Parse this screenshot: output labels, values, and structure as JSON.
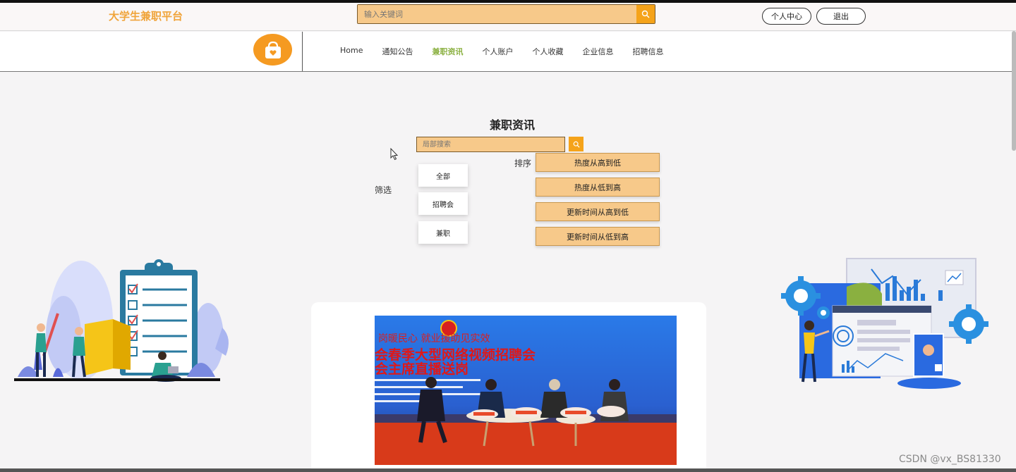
{
  "header": {
    "site_title": "大学生兼职平台",
    "search_placeholder": "输入关键词",
    "personal_center": "个人中心",
    "logout": "退出"
  },
  "nav": {
    "items": [
      {
        "label": "Home",
        "active": false
      },
      {
        "label": "通知公告",
        "active": false
      },
      {
        "label": "兼职资讯",
        "active": true
      },
      {
        "label": "个人账户",
        "active": false
      },
      {
        "label": "个人收藏",
        "active": false
      },
      {
        "label": "企业信息",
        "active": false
      },
      {
        "label": "招聘信息",
        "active": false
      }
    ]
  },
  "main": {
    "title": "兼职资讯",
    "local_search_placeholder": "局部搜索",
    "filter_label": "筛选",
    "filters": [
      "全部",
      "招聘会",
      "兼职"
    ],
    "sort_label": "排序",
    "sorts": [
      "热度从高到低",
      "热度从低到高",
      "更新时间从高到低",
      "更新时间从低到高"
    ]
  },
  "news_card": {
    "banner_line1": "岗暖民心  就业援助见实效",
    "banner_line2": "会春季大型网络视频招聘会",
    "banner_line3": "会主席直播送岗"
  },
  "watermark": "CSDN @vx_BS81330",
  "colors": {
    "accent": "#f5a31a",
    "search_bg": "#f7c98a",
    "active_nav": "#8ab040",
    "title_orange": "#f0a43a"
  }
}
